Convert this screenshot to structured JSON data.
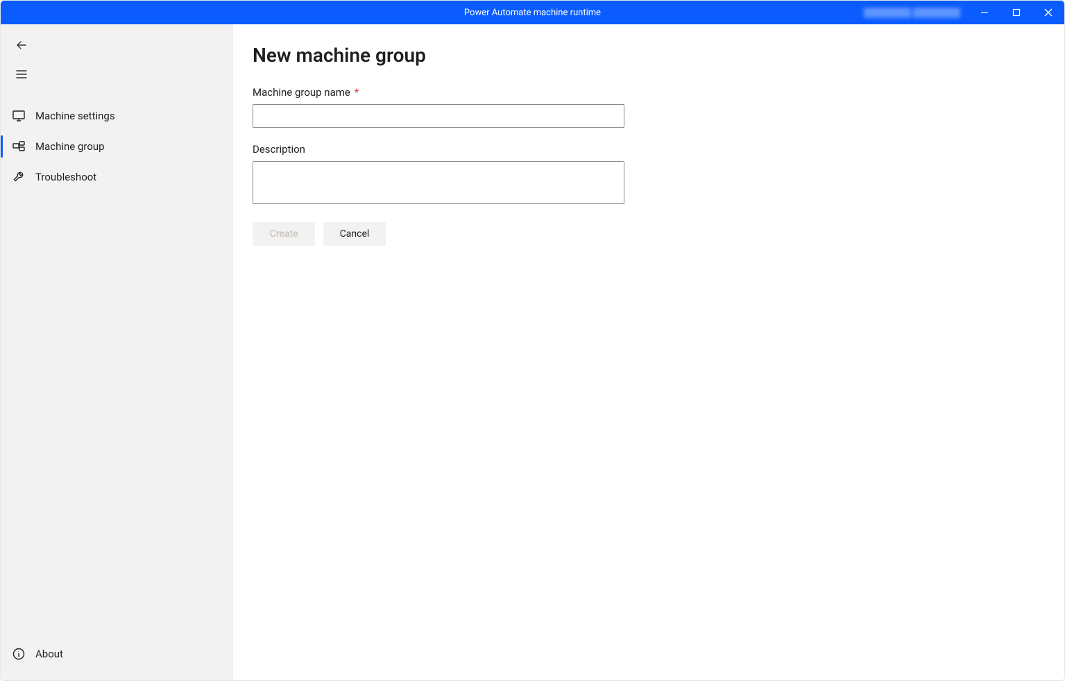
{
  "window": {
    "title": "Power Automate machine runtime"
  },
  "sidebar": {
    "items": [
      {
        "id": "machine-settings",
        "label": "Machine settings",
        "active": false
      },
      {
        "id": "machine-group",
        "label": "Machine group",
        "active": true
      },
      {
        "id": "troubleshoot",
        "label": "Troubleshoot",
        "active": false
      }
    ],
    "footer": {
      "about_label": "About"
    }
  },
  "main": {
    "page_title": "New machine group",
    "fields": {
      "name": {
        "label": "Machine group name",
        "required_marker": "*",
        "value": "",
        "placeholder": ""
      },
      "description": {
        "label": "Description",
        "value": "",
        "placeholder": ""
      }
    },
    "buttons": {
      "create_label": "Create",
      "create_disabled": true,
      "cancel_label": "Cancel"
    }
  },
  "colors": {
    "titlebar": "#0a5cff",
    "required": "#d13438"
  }
}
